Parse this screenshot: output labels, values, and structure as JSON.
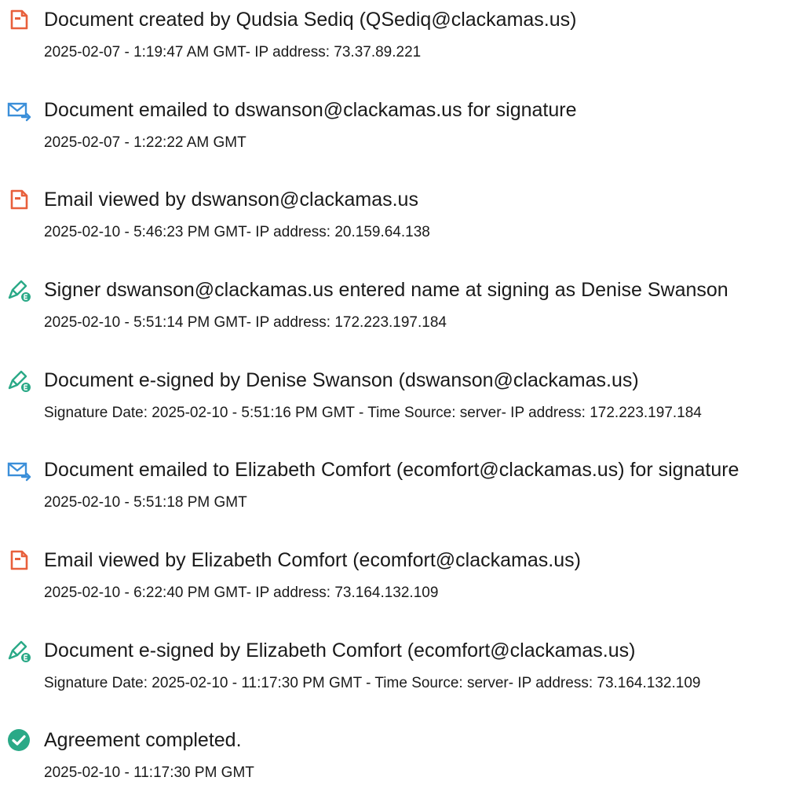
{
  "colors": {
    "doc_icon": "#e8603c",
    "mail_icon": "#3b8fd9",
    "sign_icon": "#2aa987",
    "complete_icon": "#2aa987"
  },
  "events": [
    {
      "icon": "document-icon",
      "title": "Document created by Qudsia Sediq (QSediq@clackamas.us)",
      "detail": "2025-02-07 - 1:19:47 AM GMT- IP address: 73.37.89.221"
    },
    {
      "icon": "email-send-icon",
      "title": "Document emailed to dswanson@clackamas.us for signature",
      "detail": "2025-02-07 - 1:22:22 AM GMT"
    },
    {
      "icon": "document-icon",
      "title": "Email viewed by dswanson@clackamas.us",
      "detail": "2025-02-10 - 5:46:23 PM GMT- IP address: 20.159.64.138"
    },
    {
      "icon": "pen-sign-icon",
      "title": "Signer dswanson@clackamas.us entered name at signing as Denise Swanson",
      "detail": "2025-02-10 - 5:51:14 PM GMT- IP address: 172.223.197.184"
    },
    {
      "icon": "pen-sign-icon",
      "title": "Document e-signed by Denise Swanson (dswanson@clackamas.us)",
      "detail": "Signature Date: 2025-02-10 - 5:51:16 PM GMT - Time Source: server- IP address: 172.223.197.184"
    },
    {
      "icon": "email-send-icon",
      "title": "Document emailed to Elizabeth Comfort (ecomfort@clackamas.us) for signature",
      "detail": "2025-02-10 - 5:51:18 PM GMT"
    },
    {
      "icon": "document-icon",
      "title": "Email viewed by Elizabeth Comfort (ecomfort@clackamas.us)",
      "detail": "2025-02-10 - 6:22:40 PM GMT- IP address: 73.164.132.109"
    },
    {
      "icon": "pen-sign-icon",
      "title": "Document e-signed by Elizabeth Comfort (ecomfort@clackamas.us)",
      "detail": "Signature Date: 2025-02-10 - 11:17:30 PM GMT - Time Source: server- IP address: 73.164.132.109"
    },
    {
      "icon": "checkmark-circle-icon",
      "title": "Agreement completed.",
      "detail": "2025-02-10 - 11:17:30 PM GMT"
    }
  ]
}
